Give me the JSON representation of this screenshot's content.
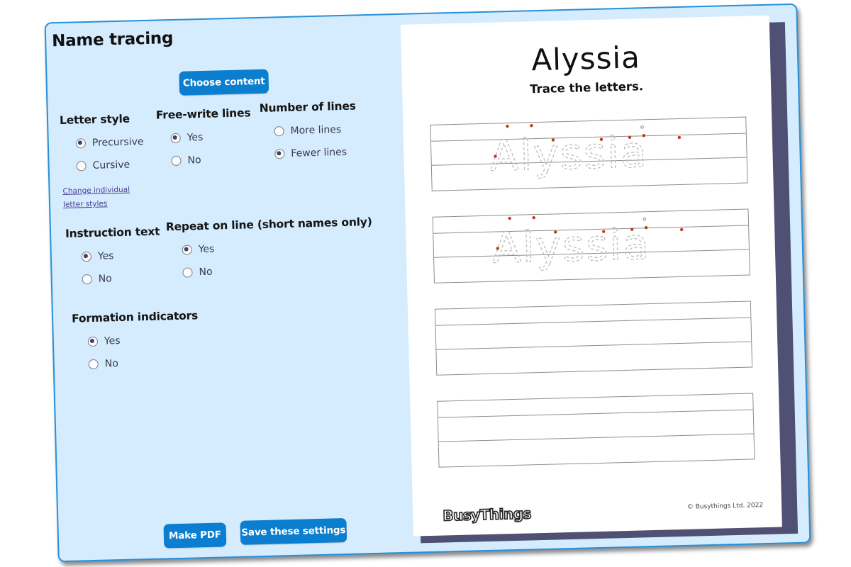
{
  "title": "Name tracing",
  "buttons": {
    "choose_content": "Choose content",
    "make_pdf": "Make PDF",
    "save_settings": "Save these settings"
  },
  "options": {
    "letter_style": {
      "label": "Letter style",
      "choices": [
        "Precursive",
        "Cursive"
      ],
      "selected": "Precursive",
      "link": [
        "Change individual",
        "letter styles"
      ]
    },
    "free_write_lines": {
      "label": "Free-write lines",
      "choices": [
        "Yes",
        "No"
      ],
      "selected": "Yes"
    },
    "number_of_lines": {
      "label": "Number of lines",
      "choices": [
        "More lines",
        "Fewer lines"
      ],
      "selected": "Fewer lines"
    },
    "instruction_text": {
      "label": "Instruction text",
      "choices": [
        "Yes",
        "No"
      ],
      "selected": "Yes"
    },
    "repeat_on_line": {
      "label": "Repeat on line (short names only)",
      "choices": [
        "Yes",
        "No"
      ],
      "selected": "Yes"
    },
    "formation_indicators": {
      "label": "Formation indicators",
      "choices": [
        "Yes",
        "No"
      ],
      "selected": "Yes"
    }
  },
  "preview": {
    "name": "Alyssia",
    "instruction": "Trace the letters.",
    "trace_name": "Alyssia",
    "line_sets": 4,
    "traced_line_sets": 2,
    "logo": "BusyThings",
    "copyright": "© Busythings Ltd. 2022"
  },
  "colors": {
    "panel_bg": "#d4ecfd",
    "accent": "#0c7ed0",
    "indicator_dot": "#c0391b",
    "paper_shadow": "#4f5073"
  }
}
